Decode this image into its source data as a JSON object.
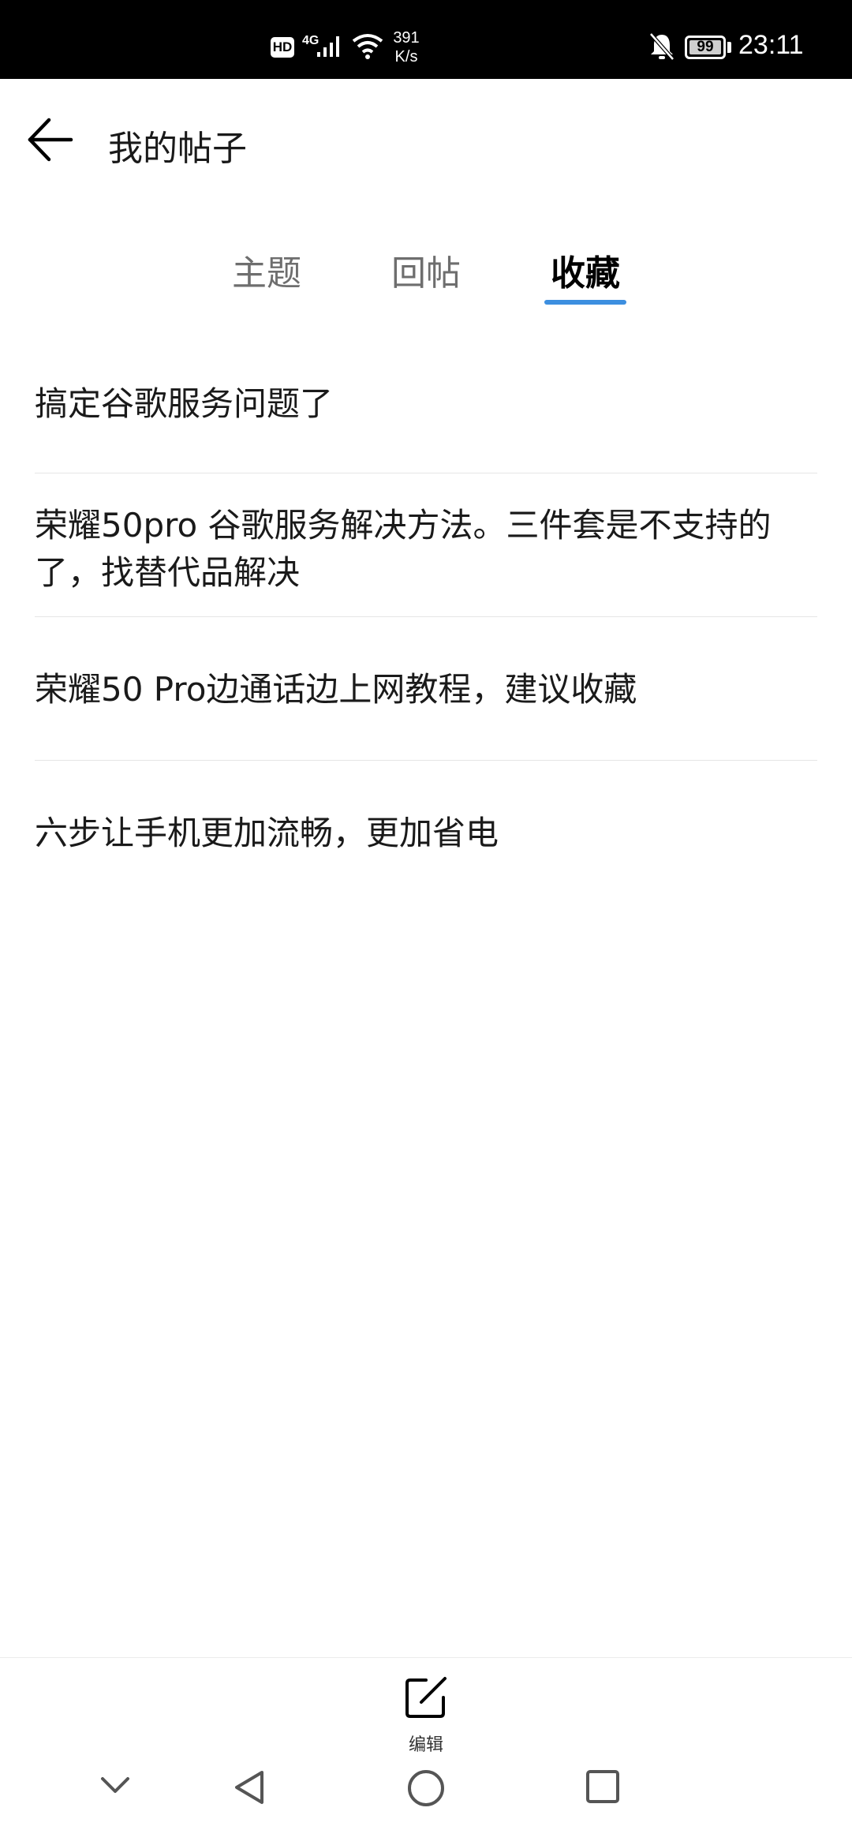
{
  "status_bar": {
    "hd": "HD",
    "network": "4G",
    "speed_value": "391",
    "speed_unit": "K/s",
    "battery": "99",
    "time": "23:11",
    "icons": [
      "signal-icon",
      "wifi-icon",
      "bell-muted-icon",
      "battery-icon"
    ]
  },
  "header": {
    "title": "我的帖子",
    "back_icon": "arrow-left-icon"
  },
  "tabs": {
    "items": [
      {
        "label": "主题"
      },
      {
        "label": "回帖"
      },
      {
        "label": "收藏"
      }
    ],
    "active_index": 2,
    "accent_color": "#3d8fe0"
  },
  "posts": [
    {
      "title": "搞定谷歌服务问题了"
    },
    {
      "title": "荣耀50pro 谷歌服务解决方法。三件套是不支持的了，找替代品解决"
    },
    {
      "title": "荣耀50 Pro边通话边上网教程，建议收藏"
    },
    {
      "title": "六步让手机更加流畅，更加省电"
    }
  ],
  "bottom_bar": {
    "edit_label": "编辑",
    "edit_icon": "edit-icon"
  },
  "nav_bar": {
    "icons": [
      "chevron-down-icon",
      "back-triangle-icon",
      "home-circle-icon",
      "recents-square-icon"
    ]
  }
}
